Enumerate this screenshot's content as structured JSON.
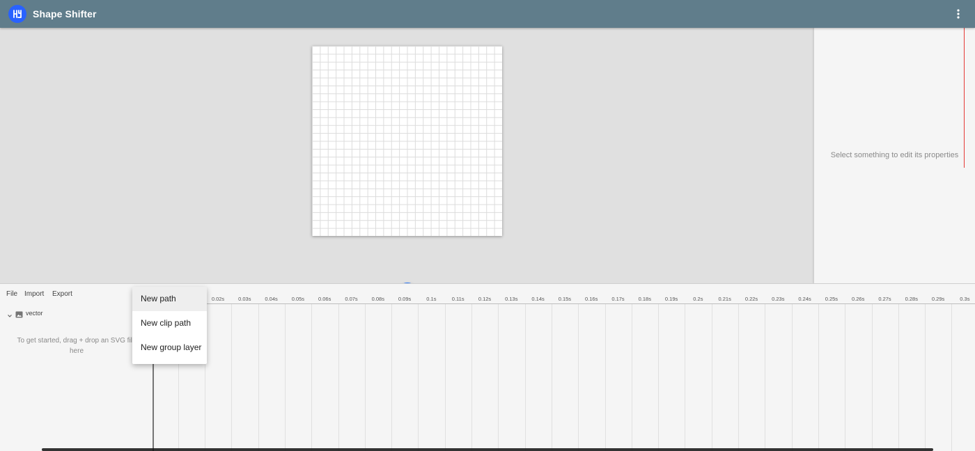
{
  "app": {
    "title": "Shape Shifter",
    "logo_icon": "shape-shifter-logo-icon",
    "more_icon": "more-vert-icon",
    "bar_color": "#607d8b",
    "accent_color": "#2979ff"
  },
  "player": {
    "buttons": [
      "playback-speed-icon",
      "skip-previous-icon",
      "play-icon",
      "skip-next-icon",
      "repeat-icon"
    ]
  },
  "properties": {
    "empty_message": "Select something to edit its properties"
  },
  "timeline": {
    "menu": {
      "file": "File",
      "import": "Import",
      "export": "Export"
    },
    "ticks": [
      "0.02s",
      "0.03s",
      "0.04s",
      "0.05s",
      "0.06s",
      "0.07s",
      "0.08s",
      "0.09s",
      "0.1s",
      "0.11s",
      "0.12s",
      "0.13s",
      "0.14s",
      "0.15s",
      "0.16s",
      "0.17s",
      "0.18s",
      "0.19s",
      "0.2s",
      "0.21s",
      "0.22s",
      "0.23s",
      "0.24s",
      "0.25s",
      "0.26s",
      "0.27s",
      "0.28s",
      "0.29s",
      "0.3s"
    ],
    "layer": {
      "name": "vector"
    },
    "drop_hint": "To get started, drag + drop an SVG file here",
    "playhead_color": "#e53935"
  },
  "add_layer_menu": {
    "items": [
      {
        "label": "New path",
        "active": true
      },
      {
        "label": "New clip path",
        "active": false
      },
      {
        "label": "New group layer",
        "active": false
      }
    ]
  }
}
